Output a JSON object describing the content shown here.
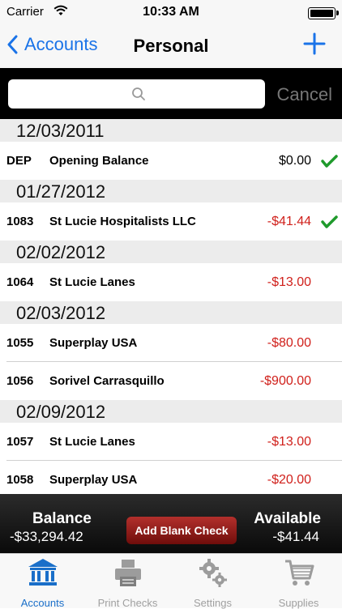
{
  "status": {
    "carrier": "Carrier",
    "time": "10:33 AM"
  },
  "nav": {
    "back_label": "Accounts",
    "title": "Personal"
  },
  "search": {
    "placeholder": "",
    "cancel_label": "Cancel"
  },
  "groups": [
    {
      "date": "12/03/2011",
      "items": [
        {
          "num": "DEP",
          "payee": "Opening Balance",
          "amount": "$0.00",
          "negative": false,
          "cleared": true
        }
      ]
    },
    {
      "date": "01/27/2012",
      "items": [
        {
          "num": "1083",
          "payee": "St Lucie Hospitalists LLC",
          "amount": "-$41.44",
          "negative": true,
          "cleared": true
        }
      ]
    },
    {
      "date": "02/02/2012",
      "items": [
        {
          "num": "1064",
          "payee": "St Lucie Lanes",
          "amount": "-$13.00",
          "negative": true,
          "cleared": false
        }
      ]
    },
    {
      "date": "02/03/2012",
      "items": [
        {
          "num": "1055",
          "payee": "Superplay USA",
          "amount": "-$80.00",
          "negative": true,
          "cleared": false
        },
        {
          "num": "1056",
          "payee": "Sorivel Carrasquillo",
          "amount": "-$900.00",
          "negative": true,
          "cleared": false
        }
      ]
    },
    {
      "date": "02/09/2012",
      "items": [
        {
          "num": "1057",
          "payee": "St Lucie Lanes",
          "amount": "-$13.00",
          "negative": true,
          "cleared": false
        },
        {
          "num": "1058",
          "payee": "Superplay USA",
          "amount": "-$20.00",
          "negative": true,
          "cleared": false
        }
      ]
    }
  ],
  "footer": {
    "balance_label": "Balance",
    "balance_value": "-$33,294.42",
    "add_blank_label": "Add Blank Check",
    "available_label": "Available",
    "available_value": "-$41.44"
  },
  "tabs": [
    {
      "label": "Accounts",
      "icon": "bank-icon",
      "active": true
    },
    {
      "label": "Print Checks",
      "icon": "printer-icon",
      "active": false
    },
    {
      "label": "Settings",
      "icon": "gears-icon",
      "active": false
    },
    {
      "label": "Supplies",
      "icon": "cart-icon",
      "active": false
    }
  ],
  "colors": {
    "accent": "#1a73e8",
    "negative": "#d0201b",
    "cleared": "#1f9a2c"
  }
}
